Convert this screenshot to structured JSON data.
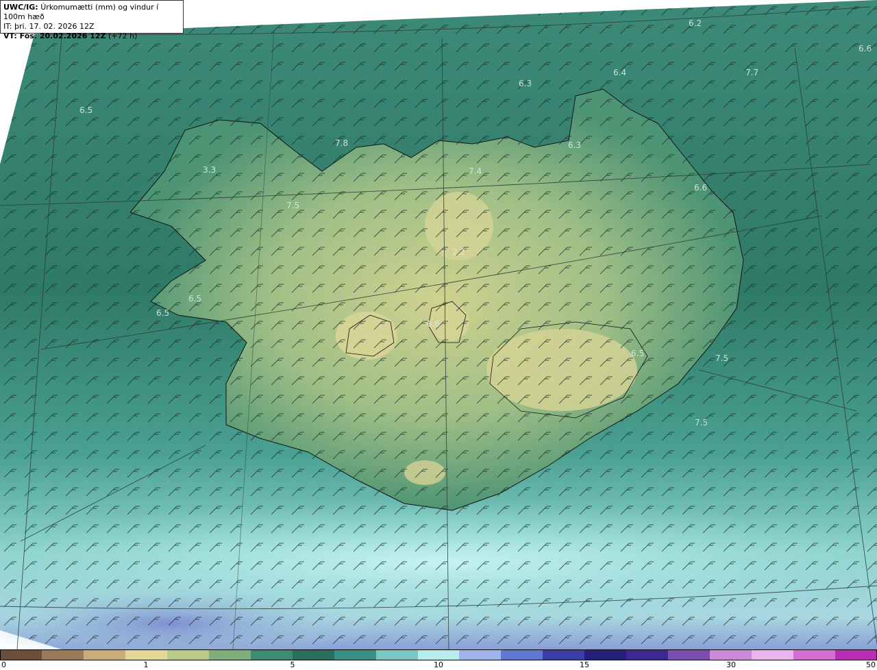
{
  "header": {
    "model_prefix": "UWC/IG:",
    "product": "Úrkomumætti (mm) og vindur í 100m hæð",
    "init_time": "IT: þri. 17. 02. 2026 12Z",
    "valid_prefix": "VT: Fös. 20.02.2026 12Z",
    "valid_suffix": "(+72 h)"
  },
  "map_labels": [
    "6.2",
    "6.6",
    "6.5",
    "6.3",
    "6.4",
    "7.7",
    "3.3",
    "7.8",
    "7.5",
    "7.4",
    "6.3",
    "6.6",
    "2.2",
    "6.5",
    "6.5",
    "6.5",
    "7.5",
    "7.5",
    "6.6"
  ],
  "colorbar": {
    "ticks": [
      "0",
      "1",
      "5",
      "10",
      "15",
      "30",
      "50"
    ],
    "colors": [
      "#6b4f3a",
      "#9a7a58",
      "#c7ad7c",
      "#e4d79a",
      "#b9c98a",
      "#7fae7d",
      "#3f8a72",
      "#2b6e60",
      "#3d8f86",
      "#7cc5c0",
      "#b7ecec",
      "#9fb4e8",
      "#5f78d0",
      "#3a3fa8",
      "#24207a",
      "#3d2a8f",
      "#7a4fb0",
      "#c98ad8",
      "#e8b6ea",
      "#d26fd0",
      "#b62fb5"
    ]
  }
}
